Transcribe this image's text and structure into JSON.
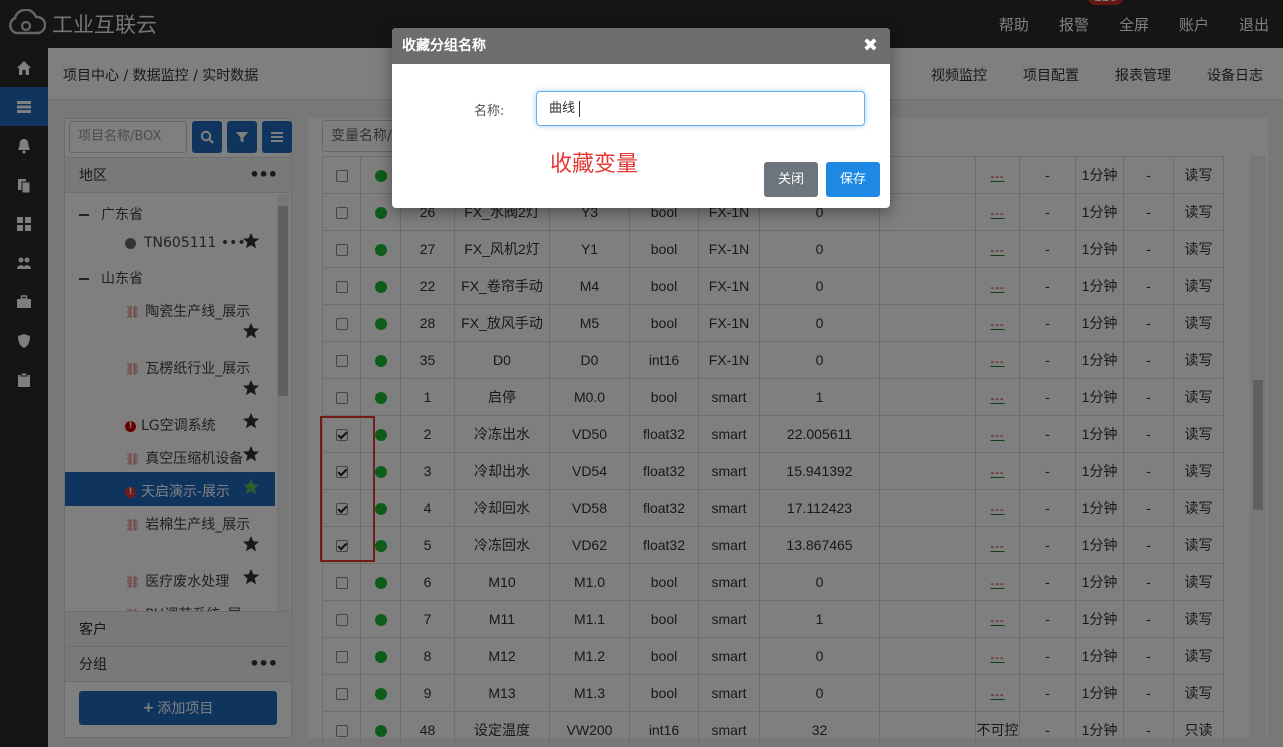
{
  "app": {
    "title": "工业互联云"
  },
  "topnav": [
    {
      "label": "帮助"
    },
    {
      "label": "报警",
      "badge": "126"
    },
    {
      "label": "全屏"
    },
    {
      "label": "账户"
    },
    {
      "label": "退出"
    }
  ],
  "rail_icons": [
    "home-icon",
    "device-icon",
    "bell-icon",
    "copy-icon",
    "grid-icon",
    "users-icon",
    "briefcase-icon",
    "shield-icon",
    "clipboard-icon"
  ],
  "breadcrumb": "项目中心 / 数据监控 / 实时数据",
  "right_tabs": [
    "视频监控",
    "项目配置",
    "报表管理",
    "设备日志"
  ],
  "search": {
    "placeholder": "项目名称/BOX ID"
  },
  "sidebar": {
    "region_header": "地区",
    "tree": [
      {
        "label": "广东省",
        "type": "province"
      },
      {
        "label": "TN605111 •••",
        "type": "device-offline"
      },
      {
        "label": "山东省",
        "type": "province"
      },
      {
        "label": "陶瓷生产线_展示",
        "type": "link-broken"
      },
      {
        "label": "瓦楞纸行业_展示",
        "type": "link-broken"
      },
      {
        "label": "LG空调系统",
        "type": "alert"
      },
      {
        "label": "真空压缩机设备",
        "type": "link-broken"
      },
      {
        "label": "天启演示-展示",
        "type": "alert",
        "selected": true
      },
      {
        "label": "岩棉生产线_展示",
        "type": "link-broken"
      },
      {
        "label": "医疗废水处理",
        "type": "link-broken"
      },
      {
        "label": "PH调节系统_展",
        "type": "link-broken"
      }
    ],
    "customer_header": "客户",
    "group_header": "分组",
    "add_button": "添加项目"
  },
  "table": {
    "var_search_placeholder": "变量名称/",
    "rows": [
      {
        "checked": false,
        "id": "",
        "name": "",
        "addr": "",
        "type": "",
        "dev": "",
        "value": "",
        "rate": "1分钟",
        "rw": "读写",
        "status": ""
      },
      {
        "checked": false,
        "id": "26",
        "name": "FX_水阀2灯",
        "addr": "Y3",
        "type": "bool",
        "dev": "FX-1N",
        "value": "0",
        "rate": "1分钟",
        "rw": "读写",
        "status": ""
      },
      {
        "checked": false,
        "id": "27",
        "name": "FX_风机2灯",
        "addr": "Y1",
        "type": "bool",
        "dev": "FX-1N",
        "value": "0",
        "rate": "1分钟",
        "rw": "读写",
        "status": ""
      },
      {
        "checked": false,
        "id": "22",
        "name": "FX_卷帘手动",
        "addr": "M4",
        "type": "bool",
        "dev": "FX-1N",
        "value": "0",
        "rate": "1分钟",
        "rw": "读写",
        "status": ""
      },
      {
        "checked": false,
        "id": "28",
        "name": "FX_放风手动",
        "addr": "M5",
        "type": "bool",
        "dev": "FX-1N",
        "value": "0",
        "rate": "1分钟",
        "rw": "读写",
        "status": ""
      },
      {
        "checked": false,
        "id": "35",
        "name": "D0",
        "addr": "D0",
        "type": "int16",
        "dev": "FX-1N",
        "value": "0",
        "rate": "1分钟",
        "rw": "读写",
        "status": ""
      },
      {
        "checked": false,
        "id": "1",
        "name": "启停",
        "addr": "M0.0",
        "type": "bool",
        "dev": "smart",
        "value": "1",
        "rate": "1分钟",
        "rw": "读写",
        "status": ""
      },
      {
        "checked": true,
        "id": "2",
        "name": "冷冻出水",
        "addr": "VD50",
        "type": "float32",
        "dev": "smart",
        "value": "22.005611",
        "rate": "1分钟",
        "rw": "读写",
        "status": ""
      },
      {
        "checked": true,
        "id": "3",
        "name": "冷却出水",
        "addr": "VD54",
        "type": "float32",
        "dev": "smart",
        "value": "15.941392",
        "rate": "1分钟",
        "rw": "读写",
        "status": ""
      },
      {
        "checked": true,
        "id": "4",
        "name": "冷却回水",
        "addr": "VD58",
        "type": "float32",
        "dev": "smart",
        "value": "17.112423",
        "rate": "1分钟",
        "rw": "读写",
        "status": ""
      },
      {
        "checked": true,
        "id": "5",
        "name": "冷冻回水",
        "addr": "VD62",
        "type": "float32",
        "dev": "smart",
        "value": "13.867465",
        "rate": "1分钟",
        "rw": "读写",
        "status": ""
      },
      {
        "checked": false,
        "id": "6",
        "name": "M10",
        "addr": "M1.0",
        "type": "bool",
        "dev": "smart",
        "value": "0",
        "rate": "1分钟",
        "rw": "读写",
        "status": ""
      },
      {
        "checked": false,
        "id": "7",
        "name": "M11",
        "addr": "M1.1",
        "type": "bool",
        "dev": "smart",
        "value": "1",
        "rate": "1分钟",
        "rw": "读写",
        "status": ""
      },
      {
        "checked": false,
        "id": "8",
        "name": "M12",
        "addr": "M1.2",
        "type": "bool",
        "dev": "smart",
        "value": "0",
        "rate": "1分钟",
        "rw": "读写",
        "status": ""
      },
      {
        "checked": false,
        "id": "9",
        "name": "M13",
        "addr": "M1.3",
        "type": "bool",
        "dev": "smart",
        "value": "0",
        "rate": "1分钟",
        "rw": "读写",
        "status": ""
      },
      {
        "checked": false,
        "id": "48",
        "name": "设定温度",
        "addr": "VW200",
        "type": "int16",
        "dev": "smart",
        "value": "32",
        "rate": "1分钟",
        "rw": "只读",
        "status": "不可控"
      }
    ],
    "alarm_glyph": "---",
    "dash": "-"
  },
  "modal": {
    "title": "收藏分组名称",
    "field_label": "名称:",
    "field_value": "曲线",
    "annotation": "收藏变量",
    "close_label": "关闭",
    "save_label": "保存"
  },
  "colors": {
    "primary": "#1e6bbf",
    "online": "#1bb934",
    "highlight_box": "#e53935"
  }
}
